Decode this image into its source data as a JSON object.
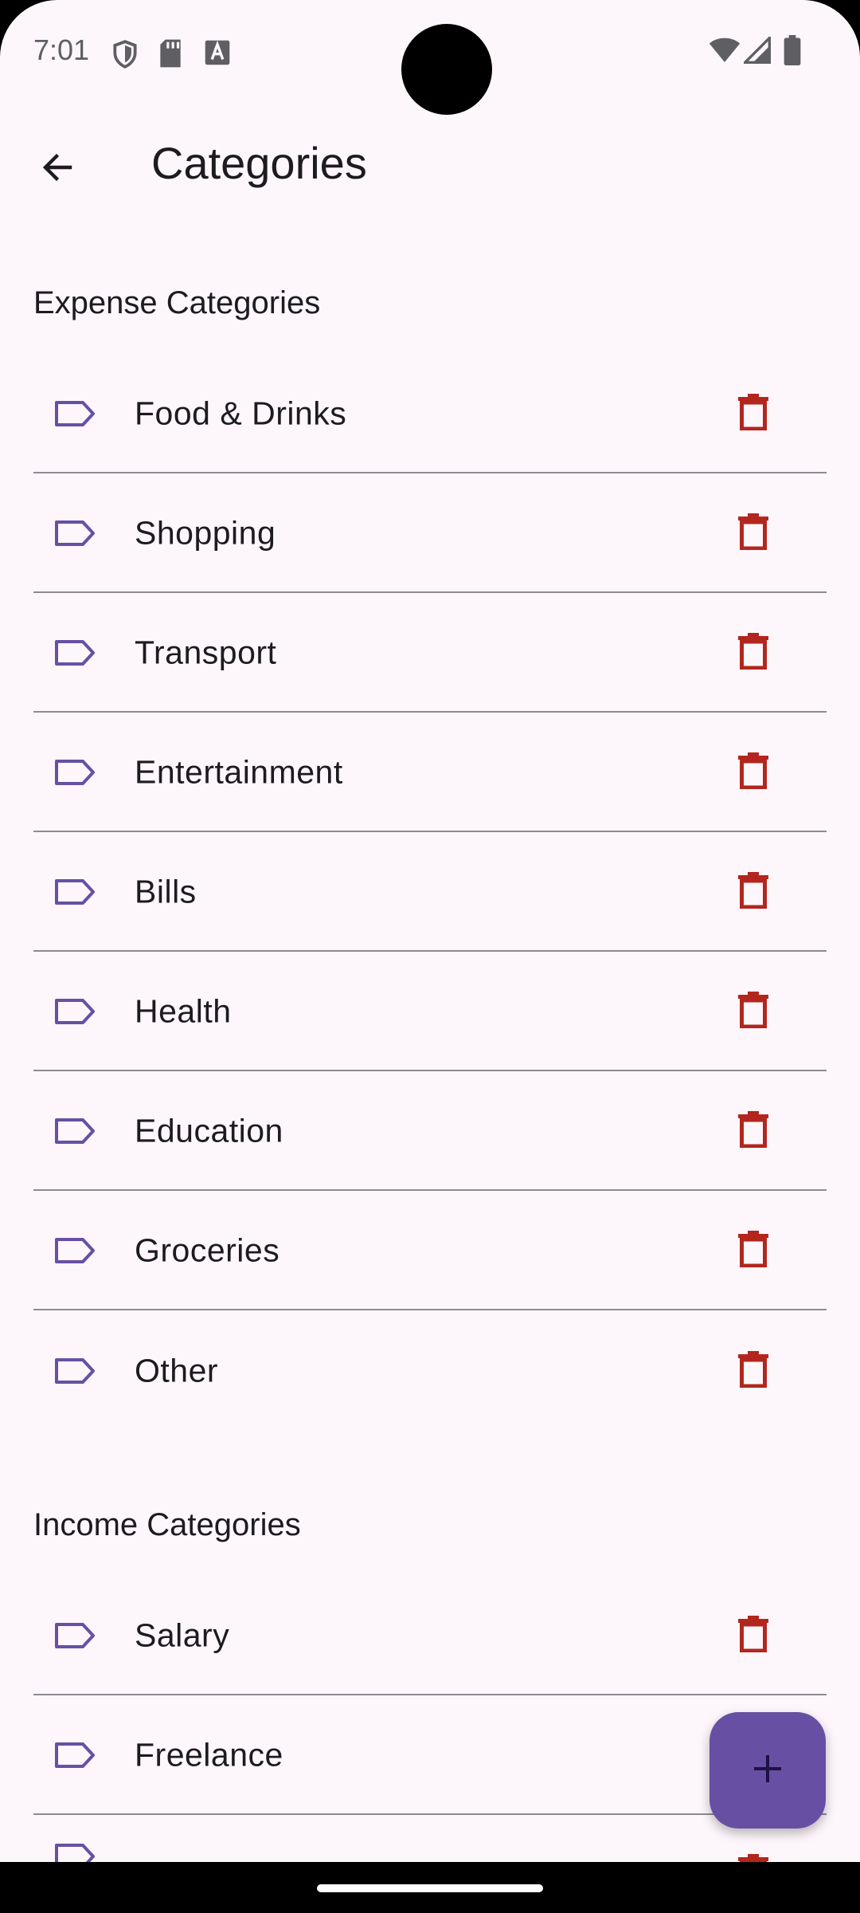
{
  "status_bar": {
    "time": "7:01",
    "left_icons": [
      "shield-icon",
      "sd-card-icon",
      "keyboard-a-icon"
    ],
    "right_icons": [
      "wifi-icon",
      "signal-icon",
      "battery-icon"
    ]
  },
  "app_bar": {
    "back_icon": "arrow-back-icon",
    "title": "Categories"
  },
  "expense_section": {
    "title": "Expense Categories",
    "items": [
      {
        "label": "Food & Drinks"
      },
      {
        "label": "Shopping"
      },
      {
        "label": "Transport"
      },
      {
        "label": "Entertainment"
      },
      {
        "label": "Bills"
      },
      {
        "label": "Health"
      },
      {
        "label": "Education"
      },
      {
        "label": "Groceries"
      },
      {
        "label": "Other"
      }
    ]
  },
  "income_section": {
    "title": "Income Categories",
    "items": [
      {
        "label": "Salary"
      },
      {
        "label": "Freelance"
      },
      {
        "label": ""
      }
    ]
  },
  "colors": {
    "background": "#FDF7FC",
    "accent": "#6750A4",
    "tag_icon": "#6750A4",
    "delete_icon": "#B3261E",
    "divider": "#8F8A92"
  },
  "fab": {
    "icon": "add-icon"
  }
}
